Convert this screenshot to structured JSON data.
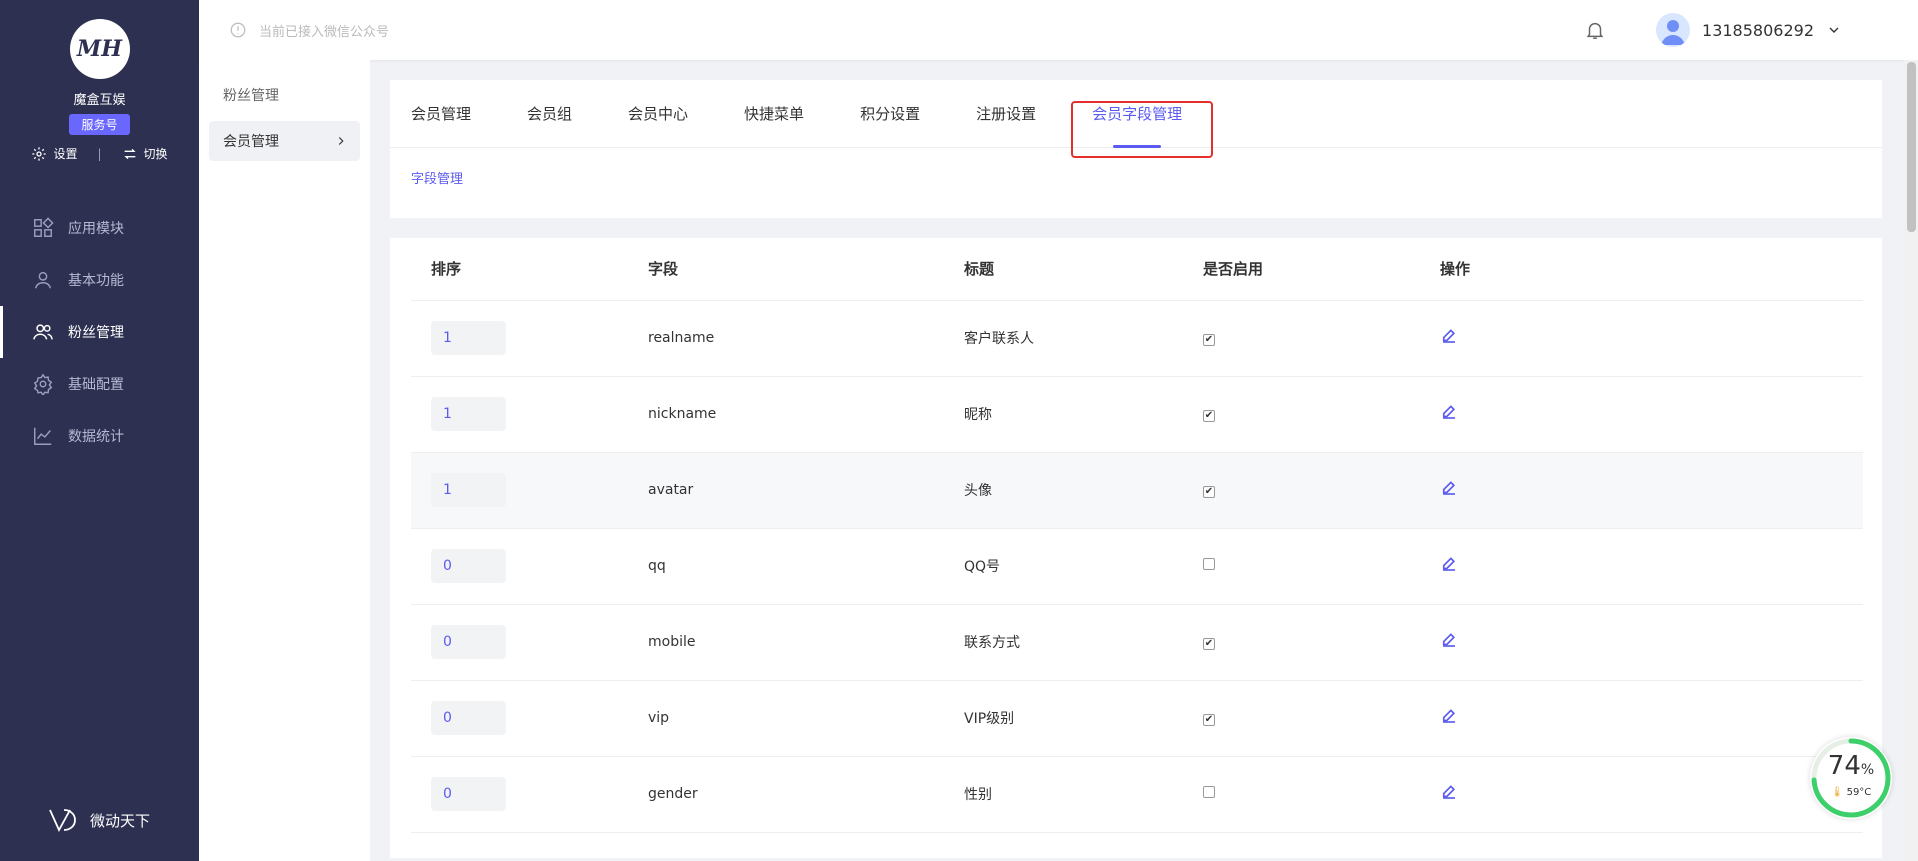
{
  "brand": {
    "logo_text": "MH",
    "name": "魔盒互娱",
    "badge": "服务号",
    "settings_label": "设置",
    "switch_label": "切换"
  },
  "nav": [
    {
      "key": "modules",
      "label": "应用模块",
      "icon": "grid-icon"
    },
    {
      "key": "basic",
      "label": "基本功能",
      "icon": "user-icon"
    },
    {
      "key": "fans",
      "label": "粉丝管理",
      "icon": "users-icon",
      "active": true
    },
    {
      "key": "config",
      "label": "基础配置",
      "icon": "gear-icon"
    },
    {
      "key": "stats",
      "label": "数据统计",
      "icon": "chart-icon"
    }
  ],
  "footer_brand": "微动天下",
  "subnav": {
    "title": "粉丝管理",
    "item": "会员管理"
  },
  "topbar": {
    "notice": "当前已接入微信公众号",
    "username": "13185806292"
  },
  "tabs": [
    "会员管理",
    "会员组",
    "会员中心",
    "快捷菜单",
    "积分设置",
    "注册设置",
    "会员字段管理"
  ],
  "active_tab": 6,
  "subtab": "字段管理",
  "table": {
    "headers": [
      "排序",
      "字段",
      "标题",
      "是否启用",
      "操作"
    ],
    "rows": [
      {
        "sort": "1",
        "field": "realname",
        "title": "客户联系人",
        "enabled": true
      },
      {
        "sort": "1",
        "field": "nickname",
        "title": "昵称",
        "enabled": true
      },
      {
        "sort": "1",
        "field": "avatar",
        "title": "头像",
        "enabled": true
      },
      {
        "sort": "0",
        "field": "qq",
        "title": "QQ号",
        "enabled": false
      },
      {
        "sort": "0",
        "field": "mobile",
        "title": "联系方式",
        "enabled": true
      },
      {
        "sort": "0",
        "field": "vip",
        "title": "VIP级别",
        "enabled": true
      },
      {
        "sort": "0",
        "field": "gender",
        "title": "性别",
        "enabled": false
      }
    ]
  },
  "gauge": {
    "value": "74",
    "unit": "%",
    "temp": "59°C",
    "percent": 74
  },
  "colors": {
    "sidebar": "#2d3050",
    "accent": "#5b5bf0",
    "highlight": "#e4302b"
  }
}
